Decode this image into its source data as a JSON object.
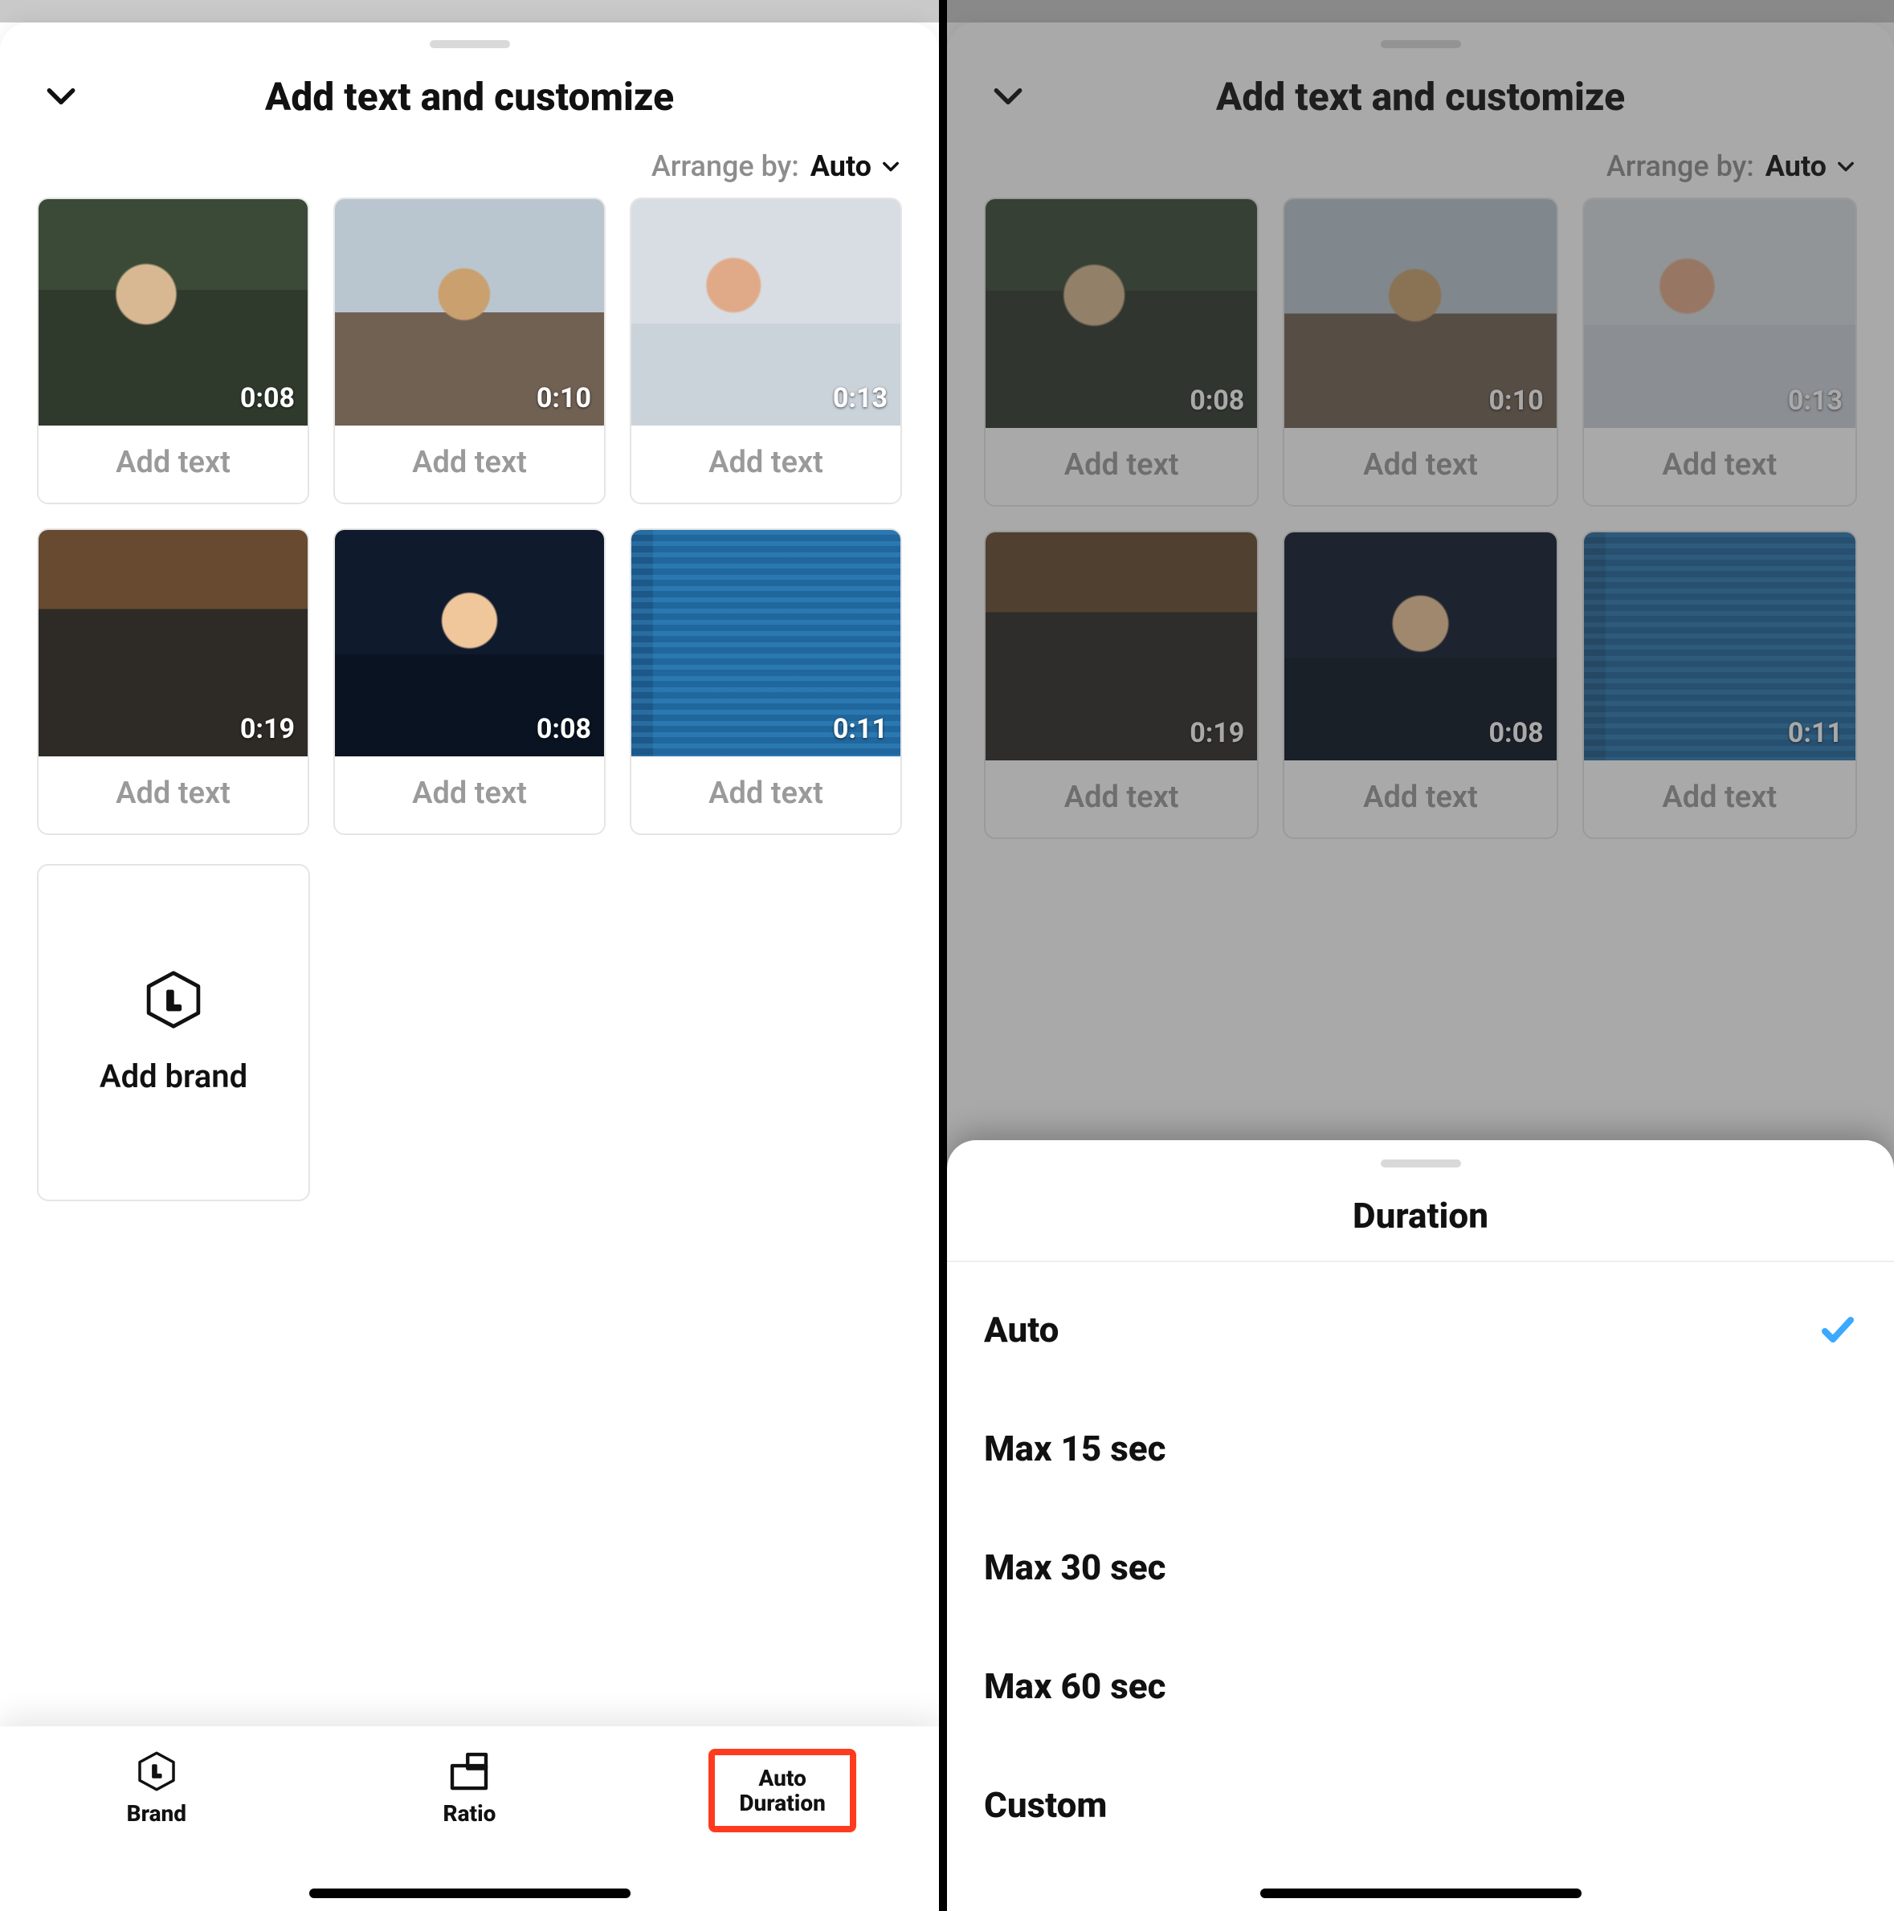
{
  "header": {
    "title": "Add text and customize",
    "arrange_label": "Arrange by:",
    "arrange_value": "Auto"
  },
  "clips": [
    {
      "duration": "0:08",
      "placeholder": "Add text"
    },
    {
      "duration": "0:10",
      "placeholder": "Add text"
    },
    {
      "duration": "0:13",
      "placeholder": "Add text"
    },
    {
      "duration": "0:19",
      "placeholder": "Add text"
    },
    {
      "duration": "0:08",
      "placeholder": "Add text"
    },
    {
      "duration": "0:11",
      "placeholder": "Add text"
    }
  ],
  "brand": {
    "label": "Add brand"
  },
  "tabs": {
    "brand": "Brand",
    "ratio": "Ratio",
    "duration_line1": "Auto",
    "duration_line2": "Duration"
  },
  "duration": {
    "title": "Duration",
    "options": [
      {
        "label": "Auto",
        "selected": true
      },
      {
        "label": "Max 15 sec",
        "selected": false
      },
      {
        "label": "Max 30 sec",
        "selected": false
      },
      {
        "label": "Max 60 sec",
        "selected": false
      },
      {
        "label": "Custom",
        "selected": false
      }
    ]
  }
}
